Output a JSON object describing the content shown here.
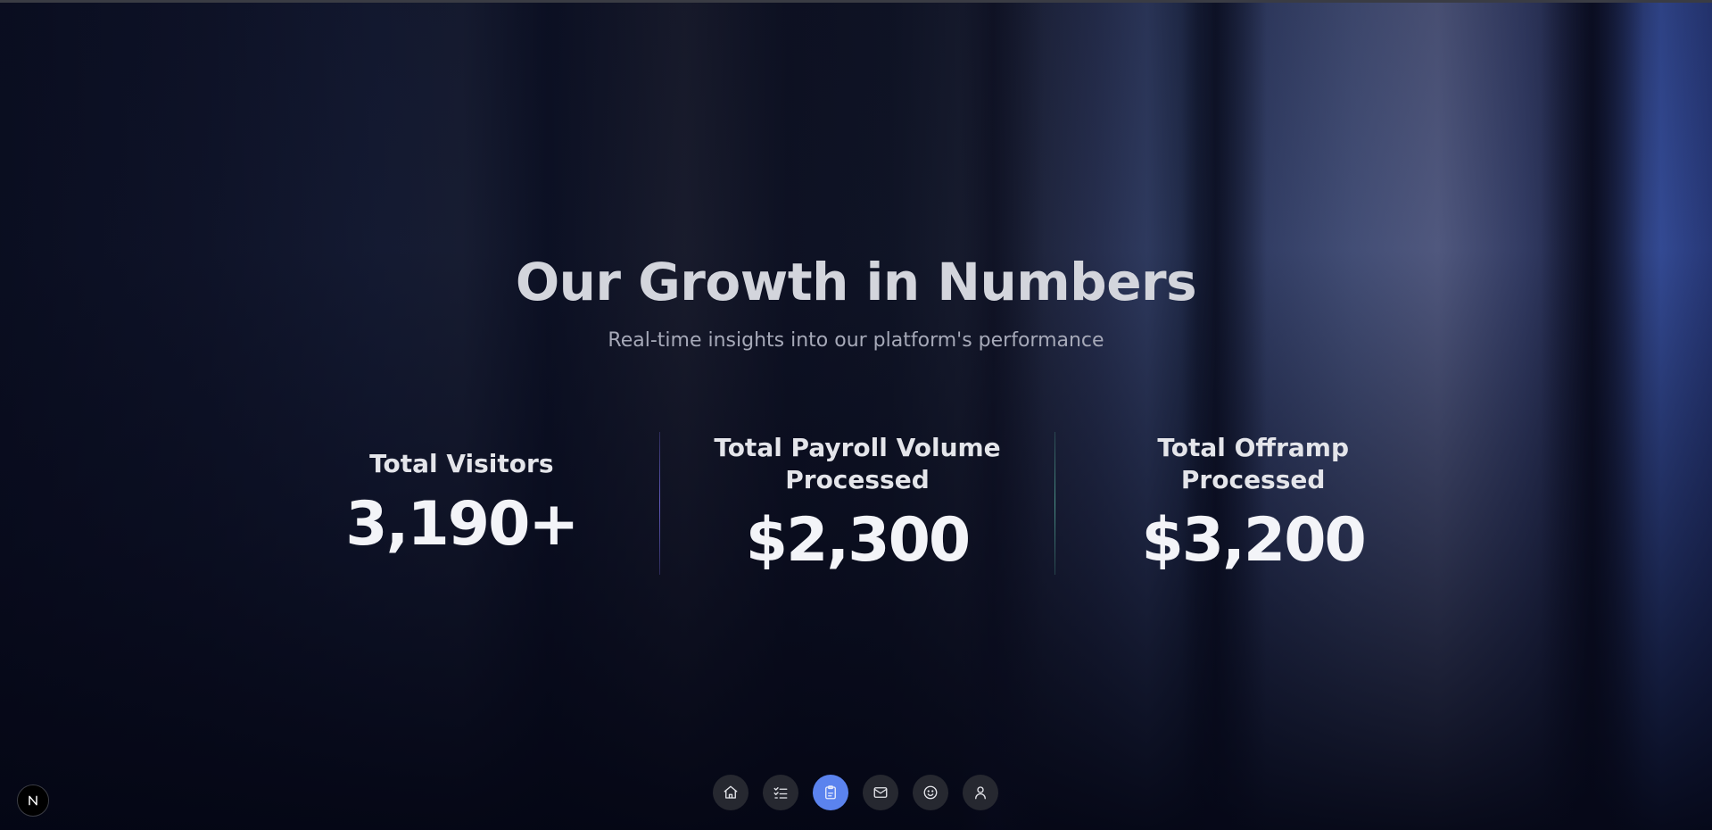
{
  "header": {
    "title": "Our Growth in Numbers",
    "subtitle": "Real-time insights into our platform's performance"
  },
  "stats": [
    {
      "label": "Total Visitors",
      "value": "3,190+"
    },
    {
      "label": "Total Payroll Volume Processed",
      "value": "$2,300"
    },
    {
      "label": "Total Offramp Processed",
      "value": "$3,200"
    }
  ],
  "dock": {
    "items": [
      {
        "icon": "home-icon",
        "active": false
      },
      {
        "icon": "checklist-icon",
        "active": false
      },
      {
        "icon": "clipboard-icon",
        "active": true
      },
      {
        "icon": "mail-icon",
        "active": false
      },
      {
        "icon": "smiley-icon",
        "active": false
      },
      {
        "icon": "user-icon",
        "active": false
      }
    ],
    "active_color": "#5b83ee",
    "button_color": "#262830"
  },
  "badge": {
    "icon": "nextjs-logo-icon",
    "letter": "N"
  }
}
